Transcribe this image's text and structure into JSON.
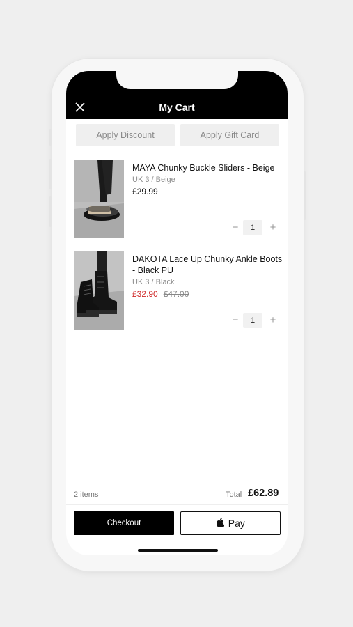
{
  "header": {
    "title": "My Cart",
    "close_icon": "close-icon"
  },
  "actions": {
    "apply_discount": "Apply Discount",
    "apply_gift_card": "Apply Gift Card"
  },
  "cart": {
    "items": [
      {
        "name": "MAYA Chunky Buckle Sliders - Beige",
        "variant": "UK 3 / Beige",
        "price": "£29.99",
        "was_price": "",
        "quantity": "1"
      },
      {
        "name": "DAKOTA Lace Up Chunky Ankle Boots - Black PU",
        "variant": "UK 3 / Black",
        "price": "£32.90",
        "was_price": "£47.00",
        "quantity": "1"
      }
    ],
    "minus_symbol": "−",
    "plus_symbol": "+"
  },
  "summary": {
    "item_count": "2 items",
    "total_label": "Total",
    "total_value": "£62.89"
  },
  "buttons": {
    "checkout": "Checkout",
    "apple_pay_text": "Pay",
    "apple_pay_icon": "apple-logo-icon"
  },
  "colors": {
    "sale_red": "#d02a2a",
    "header_bg": "#000000",
    "button_grey": "#efefef"
  }
}
